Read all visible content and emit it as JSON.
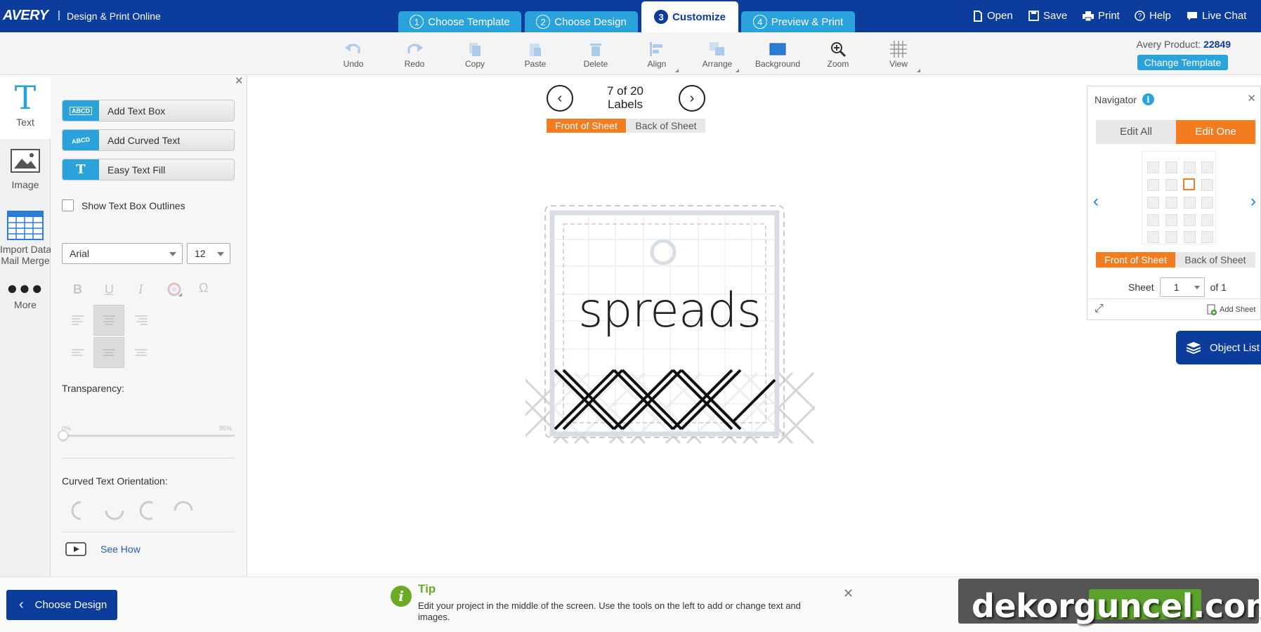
{
  "header": {
    "logo": "AVERY",
    "brand": "Design & Print Online",
    "steps": [
      {
        "num": "1",
        "label": "Choose Template"
      },
      {
        "num": "2",
        "label": "Choose Design"
      },
      {
        "num": "3",
        "label": "Customize"
      },
      {
        "num": "4",
        "label": "Preview & Print"
      }
    ],
    "actions": {
      "open": "Open",
      "save": "Save",
      "print": "Print",
      "help": "Help",
      "chat": "Live Chat"
    }
  },
  "toolbar": {
    "tools": {
      "undo": "Undo",
      "redo": "Redo",
      "copy": "Copy",
      "paste": "Paste",
      "delete": "Delete",
      "align": "Align",
      "arrange": "Arrange",
      "background": "Background",
      "zoom": "Zoom",
      "view": "View"
    },
    "product_label": "Avery Product:",
    "product_number": "22849",
    "change_template": "Change Template"
  },
  "leftnav": {
    "text": "Text",
    "image": "Image",
    "import_line1": "Import Data",
    "import_line2": "Mail Merge",
    "more": "More"
  },
  "panel": {
    "add_text_box": "Add Text Box",
    "add_text_box_icon": "ABCD",
    "add_curved_text": "Add Curved Text",
    "add_curved_text_icon": "ABCD",
    "easy_text_fill": "Easy Text Fill",
    "show_outlines": "Show Text Box Outlines",
    "font": "Arial",
    "size": "12",
    "transparency": "Transparency:",
    "slider_min": "0%",
    "slider_max": "95%",
    "transparency_value": 0,
    "curved_orientation": "Curved Text Orientation:",
    "see_how": "See How"
  },
  "canvas": {
    "count_line1": "7 of 20",
    "count_line2": "Labels",
    "front": "Front of Sheet",
    "back": "Back of Sheet",
    "label_text": "spreads"
  },
  "navigator": {
    "title": "Navigator",
    "edit_all": "Edit All",
    "edit_one": "Edit One",
    "front": "Front of Sheet",
    "back": "Back of Sheet",
    "sheet_label": "Sheet",
    "sheet_value": "1",
    "of_label": "of 1",
    "add_sheet": "Add Sheet"
  },
  "object_list": "Object List",
  "footer": {
    "choose_design": "Choose Design",
    "tip_title": "Tip",
    "tip_body": "Edit your project in the middle of the screen. Use the tools on the left to add or change text and images.",
    "watermark": "dekorguncel.com"
  },
  "colors": {
    "primary": "#0c3c9c",
    "accent": "#2aa3dd",
    "orange": "#f47c20",
    "green": "#6aaa24"
  }
}
